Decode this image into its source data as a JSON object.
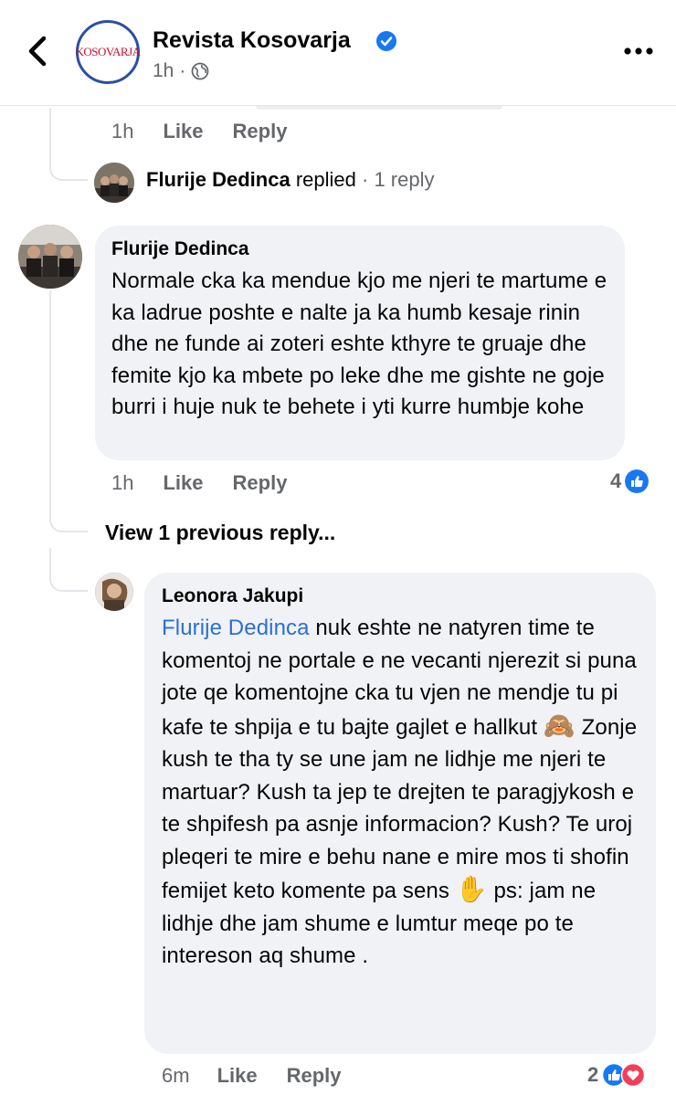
{
  "header": {
    "page_name": "Revista Kosovarja",
    "time": "1h",
    "logo_text": "KOSOVARJA",
    "icons": {
      "back": "chevron-left-icon",
      "verified": "verified-badge-icon",
      "audience": "globe-icon",
      "more": "more-options-icon"
    }
  },
  "top_actions": {
    "time": "1h",
    "like": "Like",
    "reply": "Reply"
  },
  "replied_summary": {
    "name": "Flurije Dedinca",
    "action": "replied",
    "count": "· 1 reply"
  },
  "comment_flurije": {
    "author": "Flurije Dedinca",
    "text": "Normale cka ka mendue kjo me njeri te martume e ka ladrue poshte e nalte ja ka humb kesaje rinin dhe ne funde ai zoteri eshte kthyre te gruaje dhe femite kjo ka mbete po leke dhe me gishte ne goje burri i huje nuk te behete i yti kurre humbje kohe",
    "time": "1h",
    "like": "Like",
    "reply": "Reply",
    "reaction_count": "4"
  },
  "view_previous": "View 1 previous reply...",
  "comment_leonora": {
    "author": "Leonora Jakupi",
    "mention": "Flurije Dedinca",
    "text_1": " nuk eshte ne natyren time te komentoj ne portale e ne vecanti njerezit si puna jote qe komentojne  cka tu vjen ne mendje tu pi kafe te shpija e tu bajte gajlet e hallkut ",
    "emoji_1": "🙈",
    "text_2": " Zonje kush te tha ty se une jam ne lidhje me njeri te martuar? Kush ta jep te drejten te paragjykosh e te shpifesh pa asnje informacion? Kush?  Te uroj pleqeri te mire e behu nane e mire mos ti shofin femijet keto komente pa sens ",
    "emoji_2": "✋",
    "text_3": " ps: jam ne lidhje dhe jam shume e lumtur  meqe po te intereson aq shume .",
    "time": "6m",
    "like": "Like",
    "reply": "Reply",
    "reaction_count": "2"
  },
  "colors": {
    "like_blue": "#1877f2",
    "love_red": "#f33e58",
    "mention_blue": "#2a6fd6",
    "bubble_gray": "#f0f2f5",
    "meta_gray": "#65676b"
  }
}
